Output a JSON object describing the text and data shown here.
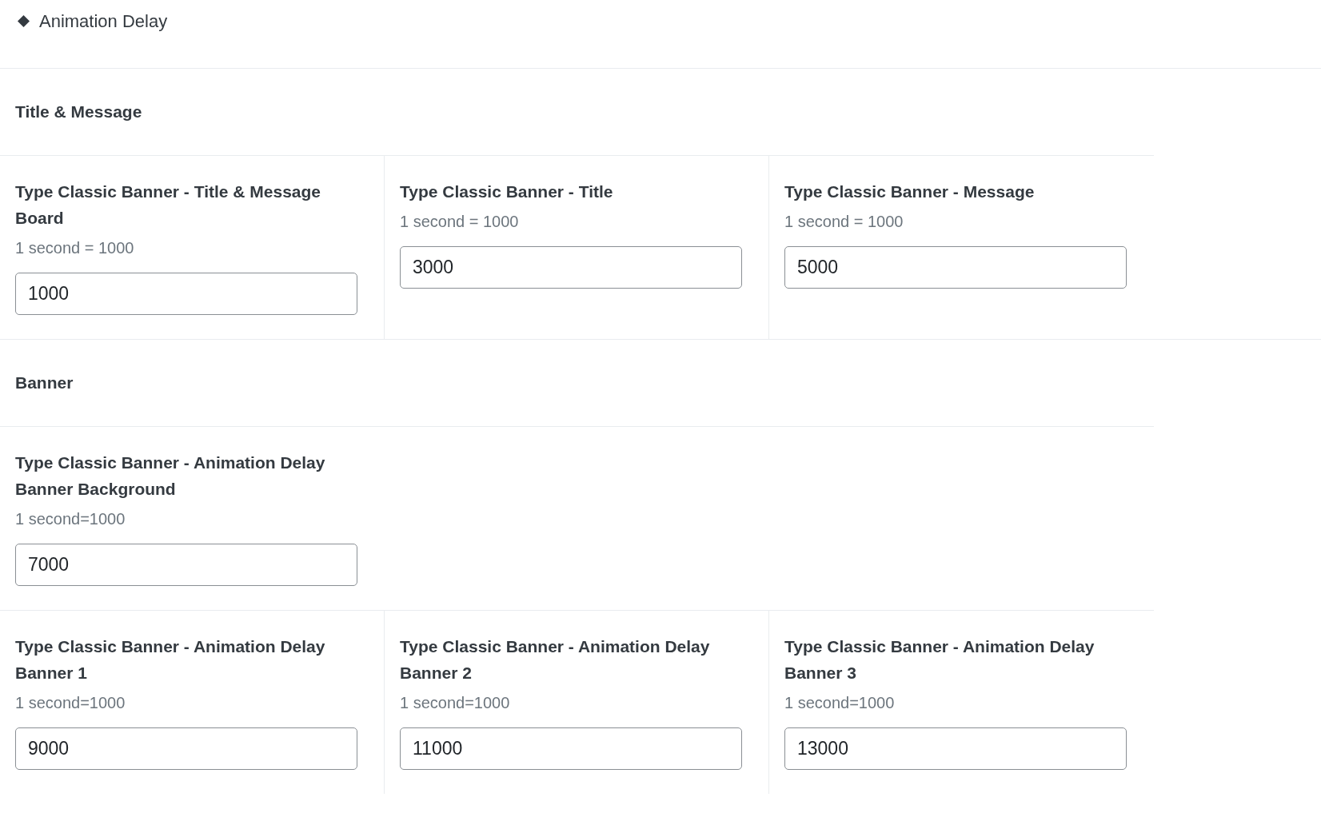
{
  "header": {
    "title": "Animation Delay"
  },
  "sections": [
    {
      "title": "Title & Message",
      "rows": [
        [
          {
            "label": "Type Classic Banner - Title & Message Board",
            "hint": "1 second = 1000",
            "value": "1000"
          },
          {
            "label": "Type Classic Banner - Title",
            "hint": "1 second = 1000",
            "value": "3000"
          },
          {
            "label": "Type Classic Banner - Message",
            "hint": "1 second = 1000",
            "value": "5000"
          }
        ]
      ]
    },
    {
      "title": "Banner",
      "rows": [
        [
          {
            "label": "Type Classic Banner - Animation Delay Banner Background",
            "hint": "1 second=1000",
            "value": "7000"
          }
        ],
        [
          {
            "label": "Type Classic Banner - Animation Delay Banner 1",
            "hint": "1 second=1000",
            "value": "9000"
          },
          {
            "label": "Type Classic Banner - Animation Delay Banner 2",
            "hint": "1 second=1000",
            "value": "11000"
          },
          {
            "label": "Type Classic Banner - Animation Delay Banner 3",
            "hint": "1 second=1000",
            "value": "13000"
          }
        ]
      ]
    }
  ]
}
